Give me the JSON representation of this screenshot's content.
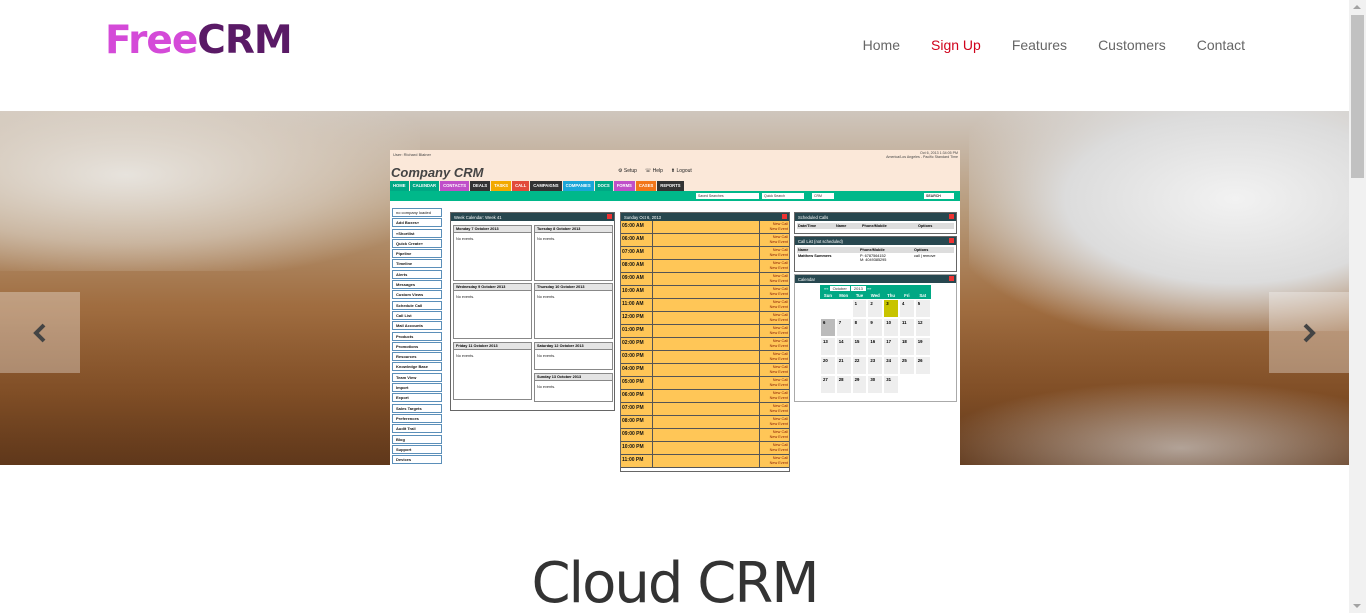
{
  "header": {
    "logo_free": "Free",
    "logo_crm": "CRM",
    "nav": [
      {
        "label": "Home"
      },
      {
        "label": "Sign Up",
        "active": true
      },
      {
        "label": "Features"
      },
      {
        "label": "Customers"
      },
      {
        "label": "Contact"
      }
    ]
  },
  "carousel": {
    "prev_icon": "chevron-left-icon",
    "next_icon": "chevron-right-icon"
  },
  "screenshot": {
    "user": "User: Richard Blainer",
    "datetime": "Oct 6, 2013 1:34:05 PM",
    "timezone": "America/Los Angeles - Pacific Standard Time",
    "brand": "Company CRM",
    "tools": [
      "Setup",
      "Help",
      "Logout"
    ],
    "tabs": [
      {
        "label": "HOME",
        "color": "#00a884"
      },
      {
        "label": "CALENDAR",
        "color": "#00a884"
      },
      {
        "label": "CONTACTS",
        "color": "#c04fc9"
      },
      {
        "label": "DEALS",
        "color": "#333333"
      },
      {
        "label": "TASKS",
        "color": "#f2a900"
      },
      {
        "label": "CALL",
        "color": "#e24a3b"
      },
      {
        "label": "CAMPAIGNS",
        "color": "#333333"
      },
      {
        "label": "COMPANIES",
        "color": "#1aa6d8"
      },
      {
        "label": "DOCS",
        "color": "#00a884"
      },
      {
        "label": "FORMS",
        "color": "#c04fc9"
      },
      {
        "label": "CASES",
        "color": "#f2761a"
      },
      {
        "label": "REPORTS",
        "color": "#333333"
      }
    ],
    "saved_searches": "Saved Searches",
    "quick_search": "Quick Search",
    "crm_select": "CRM",
    "search_btn": "SEARCH",
    "sidebar": [
      "no company loaded",
      "Add Boxes»",
      "«Shortlist",
      "Quick Create»",
      "Pipeline",
      "Timeline",
      "Alerts",
      "Messages",
      "Custom Views",
      "Schedule Call",
      "Call List",
      "Mail Accounts",
      "Products",
      "Promotions",
      "Resources",
      "Knowledge Base",
      "Team View",
      "Import",
      "Export",
      "Sales Targets",
      "Preferences",
      "Audit Trail",
      "Blog",
      "Support",
      "Devices"
    ],
    "week_title": "Week Calendar: Week 41",
    "days": [
      {
        "label": "Monday 7 October 2013",
        "body": "No events."
      },
      {
        "label": "Tuesday 8 October 2013",
        "body": "No events."
      },
      {
        "label": "Wednesday 9 October 2013",
        "body": "No events."
      },
      {
        "label": "Thursday 10 October 2013",
        "body": "No events."
      },
      {
        "label": "Friday 11 October 2013",
        "body": "No events."
      },
      {
        "label": "Saturday 12 October 2013",
        "body": "No events."
      },
      {
        "label": "Sunday 13 October 2013",
        "body": "No events."
      }
    ],
    "day_title": "Sunday Oct 6, 2013",
    "hours": [
      "05:00 AM",
      "06:00 AM",
      "07:00 AM",
      "08:00 AM",
      "09:00 AM",
      "10:00 AM",
      "11:00 AM",
      "12:00 PM",
      "01:00 PM",
      "02:00 PM",
      "03:00 PM",
      "04:00 PM",
      "05:00 PM",
      "06:00 PM",
      "07:00 PM",
      "08:00 PM",
      "09:00 PM",
      "10:00 PM",
      "11:00 PM"
    ],
    "new_call": "New Call",
    "new_event": "New Event",
    "scheduled_title": "Scheduled Calls",
    "scheduled_cols": [
      "Date/Time",
      "Name",
      "Phone/Mobile",
      "Options"
    ],
    "calllist_title": "Call List (not scheduled)",
    "calllist_cols": [
      "Name",
      "Phone/Mobile",
      "Options"
    ],
    "calllist_row": {
      "name": "Matthew Summers",
      "phone": "P: 6787564152",
      "mobile": "M: 4049385295",
      "options": "call | remove"
    },
    "calendar_title": "Calendar",
    "cal_month": "October",
    "cal_year": "2013",
    "weekdays": [
      "Sun",
      "Mon",
      "Tue",
      "Wed",
      "Thu",
      "Fri",
      "Sat"
    ],
    "weeks": [
      [
        "",
        "",
        "1",
        "2",
        "3",
        "4",
        "5"
      ],
      [
        "6",
        "7",
        "8",
        "9",
        "10",
        "11",
        "12"
      ],
      [
        "13",
        "14",
        "15",
        "16",
        "17",
        "18",
        "19"
      ],
      [
        "20",
        "21",
        "22",
        "23",
        "24",
        "25",
        "26"
      ],
      [
        "27",
        "28",
        "29",
        "30",
        "31",
        "",
        ""
      ]
    ]
  },
  "hero_title": "Cloud CRM"
}
